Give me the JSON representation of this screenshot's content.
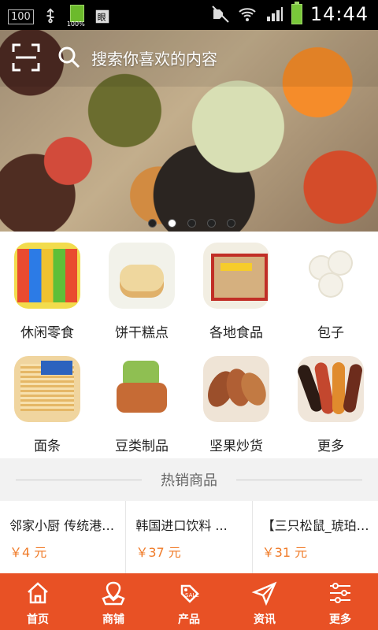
{
  "status_bar": {
    "badge": "100",
    "time": "14:44",
    "battery_text": "100%"
  },
  "header": {
    "search_placeholder": "搜索你喜欢的内容"
  },
  "banner": {
    "dot_count": 5,
    "active_dot": 1
  },
  "categories": [
    {
      "label": "休闲零食",
      "icon": "snacks-image",
      "color": "#f4e14d"
    },
    {
      "label": "饼干糕点",
      "icon": "pastry-image",
      "color": "#efe0b4"
    },
    {
      "label": "各地食品",
      "icon": "local-food-image",
      "color": "#d7b17e"
    },
    {
      "label": "包子",
      "icon": "bun-image",
      "color": "#f5f5f0"
    },
    {
      "label": "面条",
      "icon": "noodles-image",
      "color": "#e7c27a"
    },
    {
      "label": "豆类制品",
      "icon": "bean-products-image",
      "color": "#c96a2f"
    },
    {
      "label": "坚果炒货",
      "icon": "nuts-image",
      "color": "#b56a3a"
    },
    {
      "label": "更多",
      "icon": "more-food-image",
      "color": "#8f4a35"
    }
  ],
  "hot_section": {
    "title": "热销商品"
  },
  "products": [
    {
      "name": "邻家小厨 传统港式点心",
      "price": "￥4 元"
    },
    {
      "name": "韩国进口饮料 ...",
      "price": "￥37 元"
    },
    {
      "name": "【三只松鼠_琥珀核桃仁】",
      "price": "￥31 元"
    }
  ],
  "tabs": [
    {
      "label": "首页",
      "icon": "home-icon"
    },
    {
      "label": "商铺",
      "icon": "store-map-icon"
    },
    {
      "label": "产品",
      "icon": "sale-tag-icon"
    },
    {
      "label": "资讯",
      "icon": "send-icon"
    },
    {
      "label": "更多",
      "icon": "sliders-icon"
    }
  ],
  "colors": {
    "accent": "#e85125",
    "price": "#f07c2a"
  }
}
